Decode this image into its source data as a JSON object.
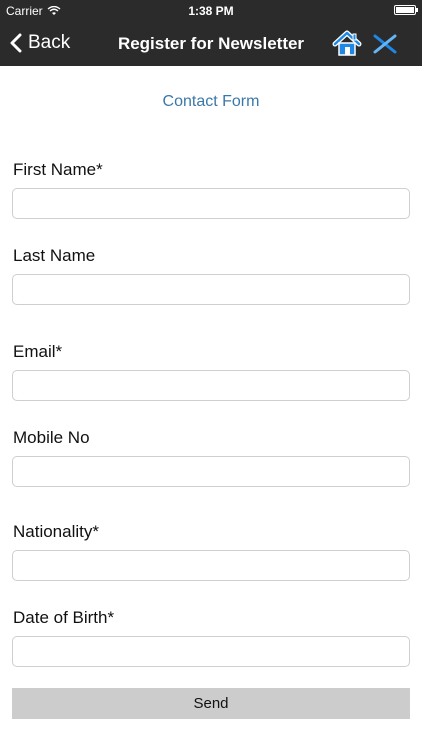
{
  "status_bar": {
    "carrier": "Carrier",
    "time": "1:38 PM",
    "battery_level": 1.0
  },
  "nav": {
    "back_label": "Back",
    "title": "Register for Newsletter",
    "home_icon": "home-icon",
    "close_icon": "close-icon",
    "icon_color": "#1e88e5"
  },
  "form": {
    "title": "Contact Form",
    "fields": [
      {
        "label": "First Name*",
        "value": "",
        "placeholder": ""
      },
      {
        "label": "Last Name",
        "value": "",
        "placeholder": ""
      },
      {
        "label": "Email*",
        "value": "",
        "placeholder": ""
      },
      {
        "label": "Mobile No",
        "value": "",
        "placeholder": ""
      },
      {
        "label": "Nationality*",
        "value": "",
        "placeholder": ""
      },
      {
        "label": "Date of Birth*",
        "value": "",
        "placeholder": ""
      }
    ],
    "send_label": "Send"
  },
  "colors": {
    "bar_background": "#2b2b2b",
    "title_accent": "#3b78a8",
    "button_background": "#cccccc"
  }
}
